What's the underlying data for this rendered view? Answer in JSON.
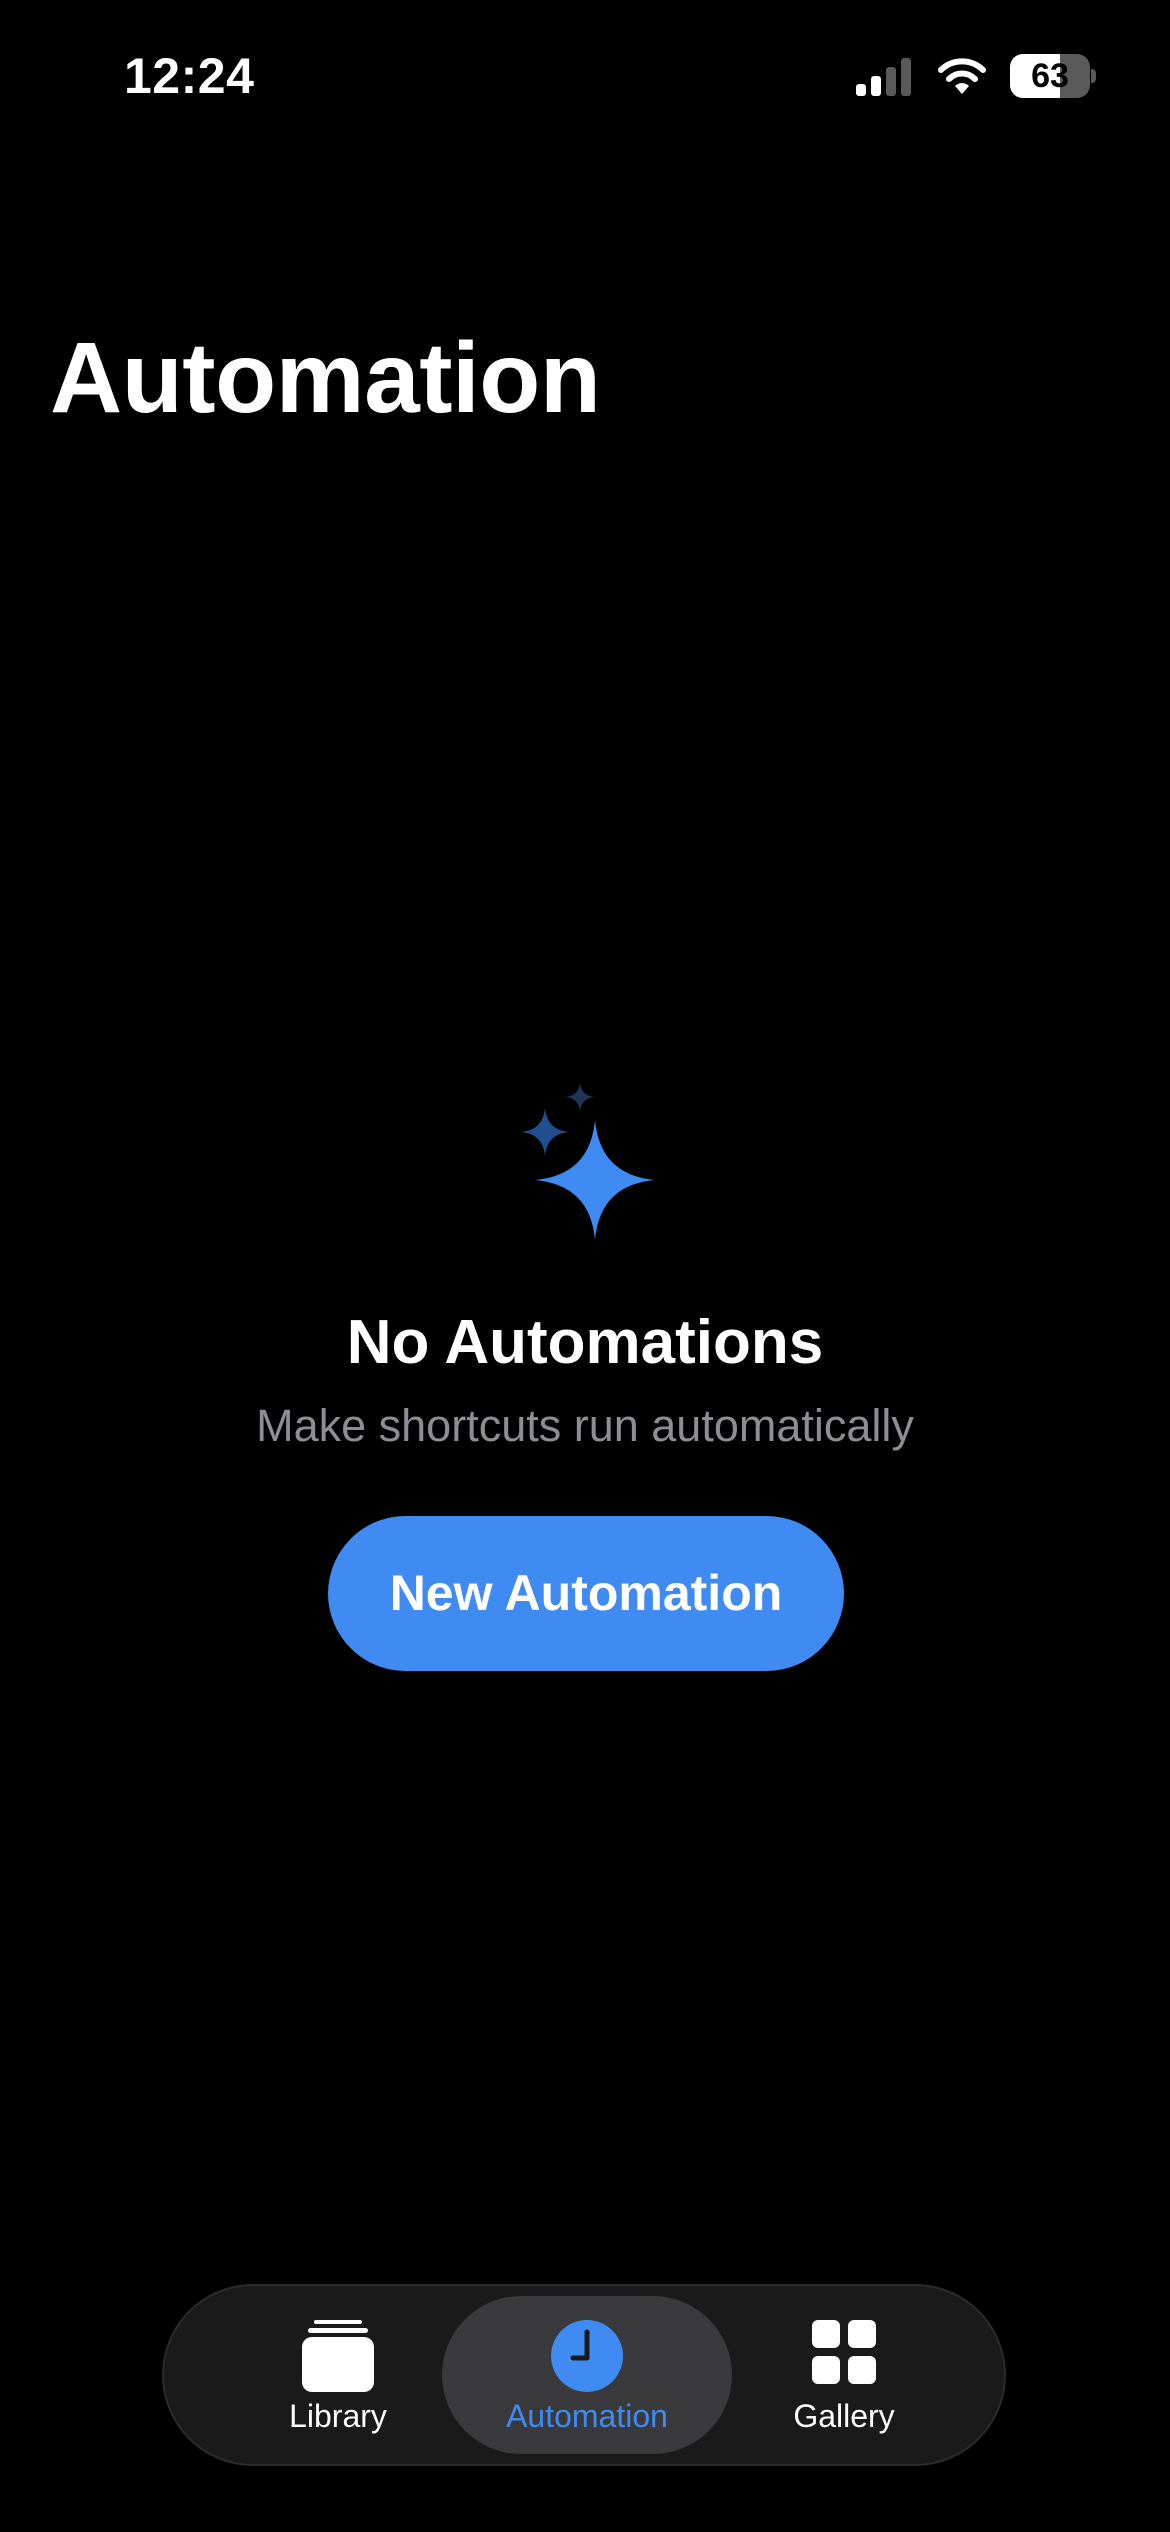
{
  "status_bar": {
    "time": "12:24",
    "battery_level": "63",
    "battery_fraction": 0.63,
    "signal_bars_active": 2,
    "signal_bars_total": 4
  },
  "header": {
    "title": "Automation"
  },
  "empty_state": {
    "icon": "sparkles-icon",
    "title": "No Automations",
    "subtitle": "Make shortcuts run automatically",
    "button_label": "New Automation"
  },
  "tab_bar": {
    "tabs": [
      {
        "label": "Library",
        "icon": "library-stack-icon",
        "selected": false
      },
      {
        "label": "Automation",
        "icon": "clock-icon",
        "selected": true
      },
      {
        "label": "Gallery",
        "icon": "grid-icon",
        "selected": false
      }
    ]
  },
  "colors": {
    "background": "#000000",
    "accent": "#3f8bf2",
    "secondary_text": "#8d8d93",
    "tab_bar_bg": "#1a1a1a",
    "selected_tab_bg": "#3a3a3c"
  }
}
